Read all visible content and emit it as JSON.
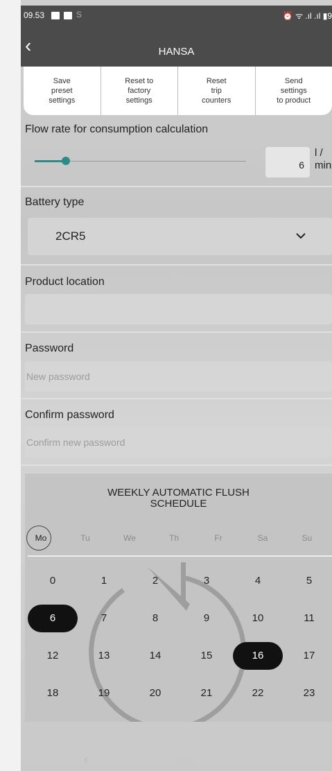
{
  "status_bar": {
    "time": "09.53",
    "right": "⏰ ᯤ .ıl .ıl ▮9"
  },
  "app_bar": {
    "back_icon": "chevron-left-icon",
    "title": "HANSA"
  },
  "toolbar": {
    "buttons": [
      "Save\npreset\nsettings",
      "Reset to\nfactory\nsettings",
      "Reset\ntrip\ncounters",
      "Send\nsettings\nto product"
    ]
  },
  "flow_rate": {
    "label": "Flow rate for consumption calculation",
    "value": "6",
    "unit": "l /\nmin",
    "slider_fraction": 0.15
  },
  "battery": {
    "label": "Battery type",
    "value": "2CR5"
  },
  "location": {
    "label": "Product location",
    "value": ""
  },
  "password": {
    "label": "Password",
    "placeholder": "New password"
  },
  "confirm_password": {
    "label": "Confirm password",
    "placeholder": "Confirm new password"
  },
  "schedule": {
    "title": "WEEKLY AUTOMATIC FLUSH\nSCHEDULE",
    "days": [
      "Mo",
      "Tu",
      "We",
      "Th",
      "Fr",
      "Sa",
      "Su"
    ],
    "selected_day": "Mo",
    "hours": [
      "0",
      "1",
      "2",
      "3",
      "4",
      "5",
      "6",
      "7",
      "8",
      "9",
      "10",
      "11",
      "12",
      "13",
      "14",
      "15",
      "16",
      "17",
      "18",
      "19",
      "20",
      "21",
      "22",
      "23"
    ],
    "selected_hours": [
      "6",
      "16"
    ]
  },
  "colors": {
    "accent": "#2b8a8a",
    "bar": "#4b4b4b",
    "selected_hour": "#111111"
  }
}
